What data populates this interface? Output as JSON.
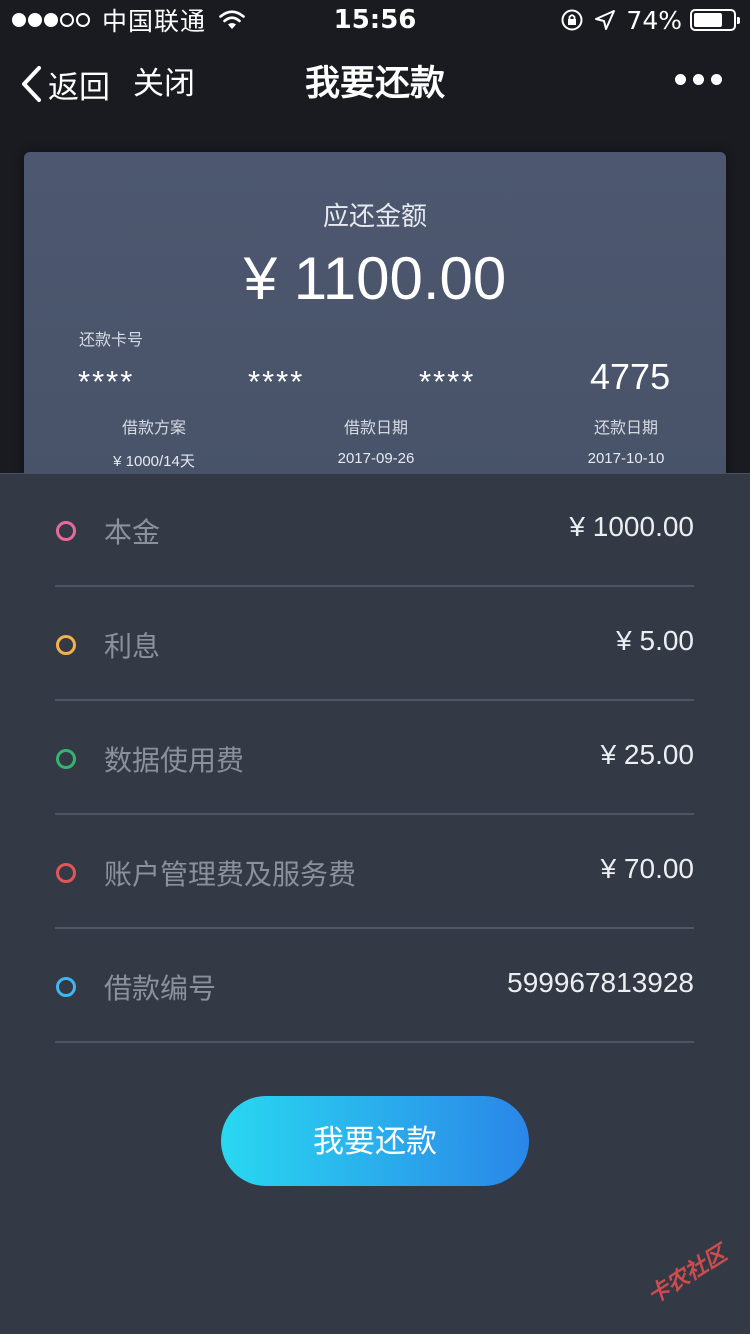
{
  "status_bar": {
    "carrier": "中国联通",
    "time": "15:56",
    "battery_percent": "74%",
    "battery_level": 0.74
  },
  "nav": {
    "back_label": "返回",
    "close_label": "关闭",
    "title": "我要还款"
  },
  "card": {
    "amount_label": "应还金额",
    "amount": "¥ 1100.00",
    "card_no_label": "还款卡号",
    "card_no_groups": [
      "****",
      "****",
      "****",
      "4775"
    ],
    "plan_label": "借款方案",
    "plan_value": "¥ 1000/14天",
    "loan_date_label": "借款日期",
    "loan_date_value": "2017-09-26",
    "repay_date_label": "还款日期",
    "repay_date_value": "2017-10-10"
  },
  "details": [
    {
      "label": "本金",
      "value": "¥ 1000.00",
      "color": "#e8699a"
    },
    {
      "label": "利息",
      "value": "¥ 5.00",
      "color": "#f2b24a"
    },
    {
      "label": "数据使用费",
      "value": "¥ 25.00",
      "color": "#35b46f"
    },
    {
      "label": "账户管理费及服务费",
      "value": "¥ 70.00",
      "color": "#e25656"
    },
    {
      "label": "借款编号",
      "value": "599967813928",
      "color": "#3fb6ef"
    }
  ],
  "action": {
    "repay_label": "我要还款"
  },
  "watermark": {
    "text": "卡农社区"
  }
}
